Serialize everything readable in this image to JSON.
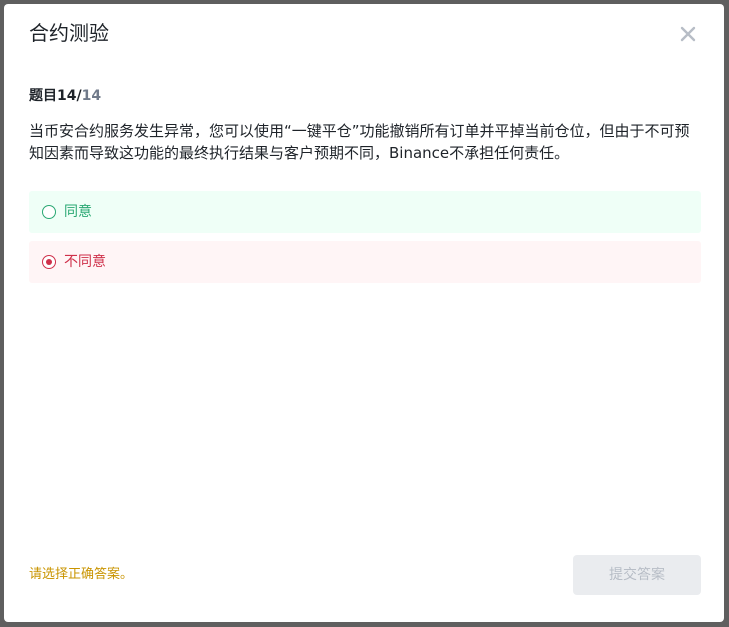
{
  "modal": {
    "title": "合约测验",
    "close_icon": "close-icon"
  },
  "question": {
    "counter_prefix": "题目",
    "current": "14",
    "separator": "/",
    "total": "14",
    "text": "当币安合约服务发生异常，您可以使用“一键平仓”功能撤销所有订单并平掉当前仓位，但由于不可预知因素而导致这功能的最终执行结果与客户预期不同，Binance不承担任何责任。"
  },
  "options": [
    {
      "label": "同意",
      "selected": false,
      "color": "#2aa873"
    },
    {
      "label": "不同意",
      "selected": true,
      "color": "#cf304a"
    }
  ],
  "footer": {
    "hint": "请选择正确答案。",
    "submit_label": "提交答案",
    "submit_enabled": false
  },
  "colors": {
    "hint": "#c99400",
    "agree_bg": "#effff7",
    "disagree_bg": "#fff5f6"
  }
}
